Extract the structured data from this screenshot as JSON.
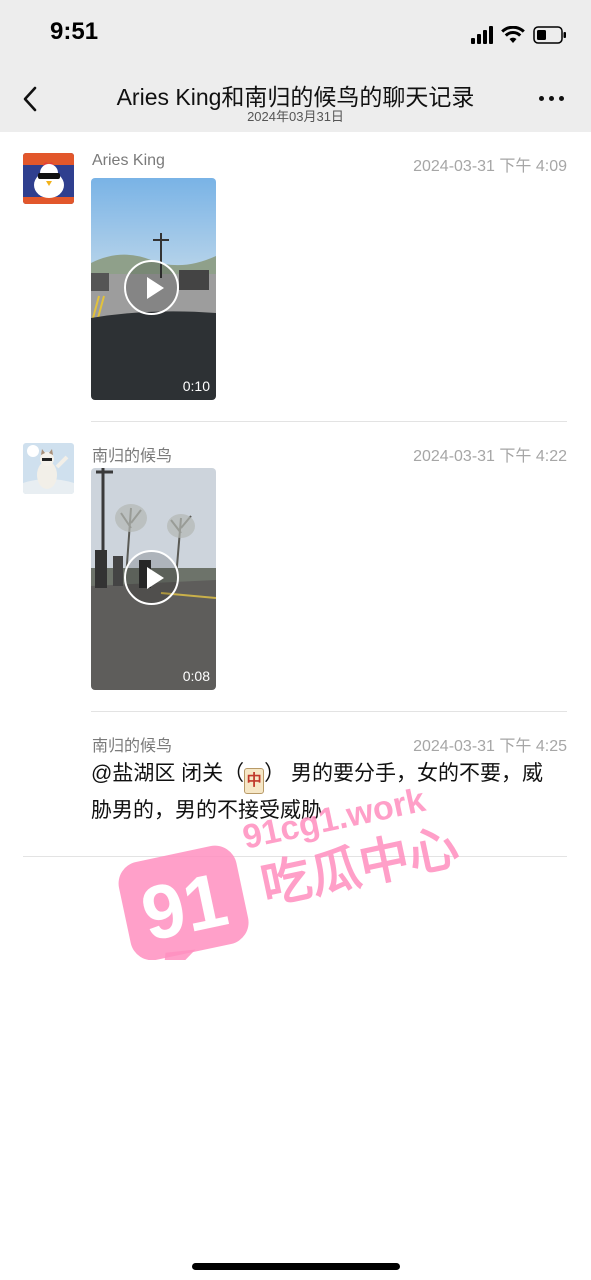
{
  "status_bar": {
    "time": "9:51"
  },
  "nav": {
    "title": "Aries King和南归的候鸟的聊天记录",
    "subtitle": "2024年03月31日",
    "back_icon": "chevron-left-icon",
    "more_icon": "more-dots-icon"
  },
  "messages": [
    {
      "sender": "Aries King",
      "timestamp": "2024-03-31 下午 4:09",
      "type": "video",
      "duration": "0:10"
    },
    {
      "sender": "南归的候鸟",
      "timestamp": "2024-03-31 下午 4:22",
      "type": "video",
      "duration": "0:08"
    },
    {
      "sender": "南归的候鸟",
      "timestamp": "2024-03-31 下午 4:25",
      "type": "text",
      "text_before": "@盐湖区 闭关（",
      "emoji": "中",
      "text_after": "）  男的要分手，女的不要，威胁男的，男的不接受威胁"
    }
  ],
  "watermark": {
    "number": "91",
    "url": "91cg1.work",
    "name": "吃瓜中心",
    "color": "#ff8fbf"
  }
}
